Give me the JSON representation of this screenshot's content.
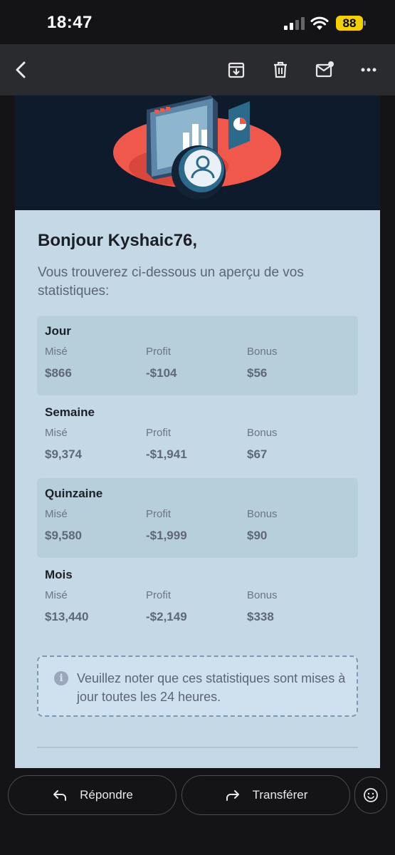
{
  "status_bar": {
    "time": "18:47",
    "battery": "88"
  },
  "toolbar": {
    "icons": [
      "back-icon",
      "archive-icon",
      "delete-icon",
      "mark-unread-icon",
      "more-icon"
    ]
  },
  "email": {
    "greeting": "Bonjour Kyshaic76,",
    "intro": "Vous trouverez ci-dessous un aperçu de vos statistiques:",
    "stats": [
      {
        "period": "Jour",
        "mise_label": "Misé",
        "mise": "$866",
        "profit_label": "Profit",
        "profit": "-$104",
        "bonus_label": "Bonus",
        "bonus": "$56"
      },
      {
        "period": "Semaine",
        "mise_label": "Misé",
        "mise": "$9,374",
        "profit_label": "Profit",
        "profit": "-$1,941",
        "bonus_label": "Bonus",
        "bonus": "$67"
      },
      {
        "period": "Quinzaine",
        "mise_label": "Misé",
        "mise": "$9,580",
        "profit_label": "Profit",
        "profit": "-$1,999",
        "bonus_label": "Bonus",
        "bonus": "$90"
      },
      {
        "period": "Mois",
        "mise_label": "Misé",
        "mise": "$13,440",
        "profit_label": "Profit",
        "profit": "-$2,149",
        "bonus_label": "Bonus",
        "bonus": "$338"
      }
    ],
    "note": "Veuillez noter que ces statistiques sont mises à jour toutes les 24 heures."
  },
  "actions": {
    "reply": "Répondre",
    "forward": "Transférer"
  },
  "colors": {
    "hero_bg": "#0e1b2c",
    "email_bg": "#c5d8e6",
    "accent_red": "#f0584c",
    "battery": "#f5d000"
  }
}
